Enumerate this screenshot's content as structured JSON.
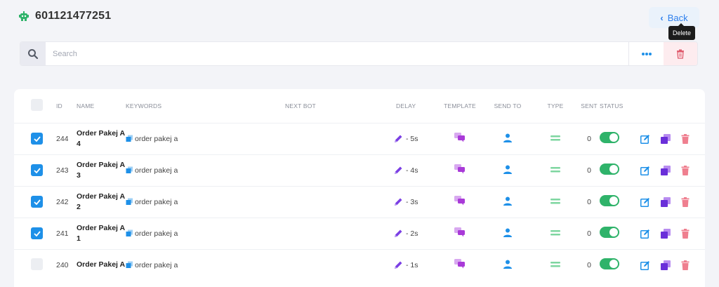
{
  "header": {
    "title": "601121477251",
    "bot_icon": "robot-icon"
  },
  "back_button": {
    "label": "Back"
  },
  "tooltip": {
    "text": "Delete"
  },
  "search": {
    "placeholder": "Search",
    "value": ""
  },
  "table": {
    "columns": [
      "ID",
      "NAME",
      "KEYWORDS",
      "NEXT BOT",
      "DELAY",
      "TEMPLATE",
      "SEND TO",
      "TYPE",
      "SENT",
      "STATUS"
    ],
    "rows": [
      {
        "checked": true,
        "id": "244",
        "name": "Order Pakej A 4",
        "keyword": "order pakej a",
        "next_bot": "",
        "delay": "- 5s",
        "sent": "0",
        "status": true
      },
      {
        "checked": true,
        "id": "243",
        "name": "Order Pakej A 3",
        "keyword": "order pakej a",
        "next_bot": "",
        "delay": "- 4s",
        "sent": "0",
        "status": true
      },
      {
        "checked": true,
        "id": "242",
        "name": "Order Pakej A 2",
        "keyword": "order pakej a",
        "next_bot": "",
        "delay": "- 3s",
        "sent": "0",
        "status": true
      },
      {
        "checked": true,
        "id": "241",
        "name": "Order Pakej A 1",
        "keyword": "order pakej a",
        "next_bot": "",
        "delay": "- 2s",
        "sent": "0",
        "status": true
      },
      {
        "checked": false,
        "id": "240",
        "name": "Order Pakej A",
        "keyword": "order pakej a",
        "next_bot": "",
        "delay": "- 1s",
        "sent": "0",
        "status": true
      }
    ]
  },
  "colors": {
    "accent": "#1e90e8",
    "toggle_on": "#2fb36a",
    "danger": "#e05c6e",
    "purple": "#7b3fe4"
  }
}
